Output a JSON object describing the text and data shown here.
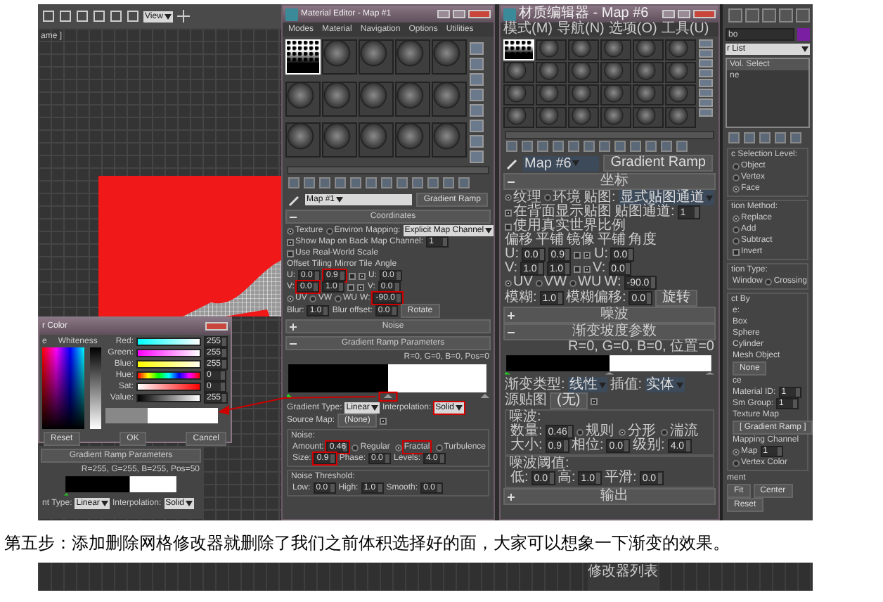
{
  "viewport": {
    "toolbar_dropdown": "View",
    "label": "ame ]"
  },
  "color_dialog": {
    "title": "r Color",
    "hue_label": "e",
    "whiteness_label": "Whiteness",
    "channels": [
      {
        "kind": "red",
        "name": "Red:",
        "value": "255"
      },
      {
        "kind": "green",
        "name": "Green:",
        "value": "255"
      },
      {
        "kind": "blue",
        "name": "Blue:",
        "value": "255"
      },
      {
        "kind": "hue",
        "name": "Hue:",
        "value": "0"
      },
      {
        "kind": "sat",
        "name": "Sat:",
        "value": "0"
      },
      {
        "kind": "value",
        "name": "Value:",
        "value": "255"
      }
    ],
    "buttons": [
      "Reset",
      "OK",
      "Cancel"
    ]
  },
  "ramp_panel": {
    "title": "Gradient Ramp Parameters",
    "readout": "R=255, G=255, B=255,  Pos=50",
    "type_label": "nt Type:",
    "type_value": "Linear",
    "interp_label": "Interpolation:",
    "interp_value": "Solid"
  },
  "editors": [
    {
      "kind": "latin",
      "title": "Material Editor - Map #1",
      "menus": [
        "Modes",
        "Material",
        "Navigation",
        "Options",
        "Utilities"
      ],
      "sample_rows": [
        [
          {
            "kind": "gradient"
          },
          {
            "kind": "sphere"
          },
          {
            "kind": "sphere"
          },
          {
            "kind": "sphere"
          },
          {
            "kind": "sphere"
          }
        ],
        [
          {
            "kind": "sphere"
          },
          {
            "kind": "sphere"
          },
          {
            "kind": "sphere"
          },
          {
            "kind": "sphere"
          },
          {
            "kind": "sphere"
          }
        ],
        [
          {
            "kind": "sphere"
          },
          {
            "kind": "sphere"
          },
          {
            "kind": "sphere"
          },
          {
            "kind": "sphere"
          },
          {
            "kind": "sphere"
          }
        ]
      ],
      "map_name": "Map #1",
      "map_type": "Gradient Ramp",
      "rows": [
        {
          "kind": "rollout",
          "title": "Coordinates",
          "expanded": true
        },
        {
          "kind": "cells",
          "cells": [
            {
              "kind": "radio",
              "label": "Texture",
              "selected": true
            },
            {
              "kind": "radio",
              "label": "Environ",
              "selected": false
            },
            {
              "kind": "label",
              "text": "Mapping:"
            },
            {
              "kind": "dropdown",
              "value": "Explicit Map Channel"
            }
          ]
        },
        {
          "kind": "cells",
          "cells": [
            {
              "kind": "check",
              "label": "Show Map on Back",
              "checked": true
            },
            {
              "kind": "label",
              "text": "Map Channel:"
            },
            {
              "kind": "field",
              "value": "1"
            }
          ]
        },
        {
          "kind": "cells",
          "cells": [
            {
              "kind": "check",
              "label": "Use Real-World Scale",
              "checked": false
            }
          ]
        },
        {
          "kind": "cells",
          "cells": [
            {
              "kind": "label",
              "text": "Offset"
            },
            {
              "kind": "label",
              "text": "Tiling"
            },
            {
              "kind": "label",
              "text": "Mirror Tile"
            },
            {
              "kind": "label",
              "text": "Angle"
            }
          ]
        },
        {
          "kind": "cells",
          "cells": [
            {
              "kind": "label",
              "text": "U:"
            },
            {
              "kind": "field",
              "value": "0.0"
            },
            {
              "kind": "field",
              "value": "0.9",
              "highlight": true
            },
            {
              "kind": "check",
              "checked": false
            },
            {
              "kind": "check",
              "checked": true
            },
            {
              "kind": "label",
              "text": "U:"
            },
            {
              "kind": "field",
              "value": "0.0"
            }
          ]
        },
        {
          "kind": "cells",
          "cells": [
            {
              "kind": "label",
              "text": "V:"
            },
            {
              "kind": "field",
              "value": "0.0",
              "highlight": true
            },
            {
              "kind": "field",
              "value": "1.0"
            },
            {
              "kind": "check",
              "checked": false
            },
            {
              "kind": "check",
              "checked": true
            },
            {
              "kind": "label",
              "text": "V:"
            },
            {
              "kind": "field",
              "value": "0.0"
            }
          ]
        },
        {
          "kind": "cells",
          "cells": [
            {
              "kind": "radio",
              "label": "UV",
              "selected": true
            },
            {
              "kind": "radio",
              "label": "VW",
              "selected": false
            },
            {
              "kind": "radio",
              "label": "WU",
              "selected": false
            },
            {
              "kind": "label",
              "text": "W:"
            },
            {
              "kind": "field",
              "value": "-90.0",
              "highlight": true
            }
          ]
        },
        {
          "kind": "cells",
          "cells": [
            {
              "kind": "label",
              "text": "Blur:"
            },
            {
              "kind": "field",
              "value": "1.0"
            },
            {
              "kind": "label",
              "text": "Blur offset:"
            },
            {
              "kind": "field",
              "value": "0.0"
            },
            {
              "kind": "button",
              "label": "Rotate"
            }
          ]
        },
        {
          "kind": "rollout",
          "title": "Noise",
          "expanded": false
        },
        {
          "kind": "rollout",
          "title": "Gradient Ramp Parameters",
          "expanded": true
        },
        {
          "kind": "ramp",
          "readout": "R=0, G=0, B=0,  Pos=0",
          "highlight": true
        },
        {
          "kind": "cells",
          "cells": [
            {
              "kind": "label",
              "text": "Gradient Type:"
            },
            {
              "kind": "dropdown",
              "value": "Linear"
            },
            {
              "kind": "label",
              "text": "Interpolation:"
            },
            {
              "kind": "dropdown",
              "value": "Solid",
              "highlight": true
            }
          ]
        },
        {
          "kind": "cells",
          "cells": [
            {
              "kind": "label",
              "text": "Source Map:"
            },
            {
              "kind": "button",
              "label": "(None)"
            },
            {
              "kind": "check",
              "checked": true
            }
          ]
        },
        {
          "kind": "group",
          "title": "Noise:",
          "rows": [
            {
              "kind": "cells",
              "cells": [
                {
                  "kind": "label",
                  "text": "Amount:"
                },
                {
                  "kind": "field",
                  "value": "0.46",
                  "highlight": true
                },
                {
                  "kind": "radios",
                  "options": [
                    {
                      "label": "Regular",
                      "selected": false
                    },
                    {
                      "label": "Fractal",
                      "selected": true,
                      "highlight": true
                    },
                    {
                      "label": "Turbulence",
                      "selected": false
                    }
                  ]
                }
              ]
            },
            {
              "kind": "cells",
              "cells": [
                {
                  "kind": "label",
                  "text": "Size:"
                },
                {
                  "kind": "field",
                  "value": "0.9",
                  "highlight": true
                },
                {
                  "kind": "label",
                  "text": "Phase:"
                },
                {
                  "kind": "field",
                  "value": "0.0"
                },
                {
                  "kind": "label",
                  "text": "Levels:"
                },
                {
                  "kind": "field",
                  "value": "4.0"
                }
              ]
            }
          ]
        },
        {
          "kind": "group",
          "title": "Noise Threshold:",
          "rows": [
            {
              "kind": "cells",
              "cells": [
                {
                  "kind": "label",
                  "text": "Low:"
                },
                {
                  "kind": "field",
                  "value": "0.0"
                },
                {
                  "kind": "label",
                  "text": "High:"
                },
                {
                  "kind": "field",
                  "value": "1.0"
                },
                {
                  "kind": "label",
                  "text": "Smooth:"
                },
                {
                  "kind": "field",
                  "value": "0.0"
                }
              ]
            }
          ]
        }
      ]
    },
    {
      "kind": "cjk",
      "title": "材质编辑器 - Map #6",
      "menus": [
        "模式(M)",
        "导航(N)",
        "选项(O)",
        "工具(U)"
      ],
      "sample_rows": [
        [
          {
            "kind": "gradient"
          },
          {
            "kind": "sphere"
          },
          {
            "kind": "sphere"
          },
          {
            "kind": "sphere"
          },
          {
            "kind": "sphere"
          },
          {
            "kind": "sphere"
          }
        ],
        [
          {
            "kind": "sphere"
          },
          {
            "kind": "sphere"
          },
          {
            "kind": "sphere"
          },
          {
            "kind": "sphere"
          },
          {
            "kind": "sphere"
          },
          {
            "kind": "sphere"
          }
        ],
        [
          {
            "kind": "sphere"
          },
          {
            "kind": "sphere"
          },
          {
            "kind": "sphere"
          },
          {
            "kind": "sphere"
          },
          {
            "kind": "sphere"
          },
          {
            "kind": "sphere"
          }
        ],
        [
          {
            "kind": "sphere"
          },
          {
            "kind": "sphere"
          },
          {
            "kind": "sphere"
          },
          {
            "kind": "sphere"
          },
          {
            "kind": "sphere"
          },
          {
            "kind": "sphere"
          }
        ]
      ],
      "map_name": "Map #6",
      "map_type": "Gradient Ramp",
      "rows": [
        {
          "kind": "rollout",
          "title": "坐标",
          "expanded": true
        },
        {
          "kind": "cells",
          "cells": [
            {
              "kind": "radio",
              "label": "纹理",
              "selected": true
            },
            {
              "kind": "radio",
              "label": "环境",
              "selected": false
            },
            {
              "kind": "label",
              "text": "贴图:"
            },
            {
              "kind": "dropdown",
              "value": "显式贴图通道"
            }
          ]
        },
        {
          "kind": "cells",
          "cells": [
            {
              "kind": "check",
              "label": "在背面显示贴图",
              "checked": true
            },
            {
              "kind": "label",
              "text": "贴图通道:"
            },
            {
              "kind": "field",
              "value": "1"
            }
          ]
        },
        {
          "kind": "cells",
          "cells": [
            {
              "kind": "check",
              "label": "使用真实世界比例",
              "checked": false
            }
          ]
        },
        {
          "kind": "cells",
          "cells": [
            {
              "kind": "label",
              "text": "偏移"
            },
            {
              "kind": "label",
              "text": "平铺"
            },
            {
              "kind": "label",
              "text": "镜像"
            },
            {
              "kind": "label",
              "text": "平铺"
            },
            {
              "kind": "label",
              "text": "角度"
            }
          ]
        },
        {
          "kind": "cells",
          "cells": [
            {
              "kind": "label",
              "text": "U:"
            },
            {
              "kind": "field",
              "value": "0.0"
            },
            {
              "kind": "field",
              "value": "0.9"
            },
            {
              "kind": "check",
              "checked": false
            },
            {
              "kind": "check",
              "checked": true
            },
            {
              "kind": "label",
              "text": "U:"
            },
            {
              "kind": "field",
              "value": "0.0"
            }
          ]
        },
        {
          "kind": "cells",
          "cells": [
            {
              "kind": "label",
              "text": "V:"
            },
            {
              "kind": "field",
              "value": "1.0"
            },
            {
              "kind": "field",
              "value": "1.0"
            },
            {
              "kind": "check",
              "checked": false
            },
            {
              "kind": "check",
              "checked": true
            },
            {
              "kind": "label",
              "text": "V:"
            },
            {
              "kind": "field",
              "value": "0.0"
            }
          ]
        },
        {
          "kind": "cells",
          "cells": [
            {
              "kind": "radio",
              "label": "UV",
              "selected": true
            },
            {
              "kind": "radio",
              "label": "VW",
              "selected": false
            },
            {
              "kind": "radio",
              "label": "WU",
              "selected": false
            },
            {
              "kind": "label",
              "text": "W:"
            },
            {
              "kind": "field",
              "value": "-90.0"
            }
          ]
        },
        {
          "kind": "cells",
          "cells": [
            {
              "kind": "label",
              "text": "模糊:"
            },
            {
              "kind": "field",
              "value": "1.0"
            },
            {
              "kind": "label",
              "text": "模糊偏移:"
            },
            {
              "kind": "field",
              "value": "0.0"
            },
            {
              "kind": "button",
              "label": "旋转"
            }
          ]
        },
        {
          "kind": "rollout",
          "title": "噪波",
          "expanded": false
        },
        {
          "kind": "rollout",
          "title": "渐变坡度参数",
          "expanded": true
        },
        {
          "kind": "ramp",
          "readout": "R=0, G=0, B=0,  位置=0"
        },
        {
          "kind": "cells",
          "cells": [
            {
              "kind": "label",
              "text": "渐变类型:"
            },
            {
              "kind": "dropdown",
              "value": "线性"
            },
            {
              "kind": "label",
              "text": "插值:"
            },
            {
              "kind": "dropdown",
              "value": "实体"
            }
          ]
        },
        {
          "kind": "cells",
          "cells": [
            {
              "kind": "label",
              "text": "源贴图"
            },
            {
              "kind": "button",
              "label": "(无)"
            },
            {
              "kind": "check",
              "checked": true
            }
          ]
        },
        {
          "kind": "group",
          "title": "噪波:",
          "rows": [
            {
              "kind": "cells",
              "cells": [
                {
                  "kind": "label",
                  "text": "数量:"
                },
                {
                  "kind": "field",
                  "value": "0.46"
                },
                {
                  "kind": "radios",
                  "options": [
                    {
                      "label": "规则",
                      "selected": false
                    },
                    {
                      "label": "分形",
                      "selected": true
                    },
                    {
                      "label": "湍流",
                      "selected": false
                    }
                  ]
                }
              ]
            },
            {
              "kind": "cells",
              "cells": [
                {
                  "kind": "label",
                  "text": "大小:"
                },
                {
                  "kind": "field",
                  "value": "0.9"
                },
                {
                  "kind": "label",
                  "text": "相位:"
                },
                {
                  "kind": "field",
                  "value": "0.0"
                },
                {
                  "kind": "label",
                  "text": "级别:"
                },
                {
                  "kind": "field",
                  "value": "4.0"
                }
              ]
            }
          ]
        },
        {
          "kind": "group",
          "title": "噪波阈值:",
          "rows": [
            {
              "kind": "cells",
              "cells": [
                {
                  "kind": "label",
                  "text": "低:"
                },
                {
                  "kind": "field",
                  "value": "0.0"
                },
                {
                  "kind": "label",
                  "text": "高:"
                },
                {
                  "kind": "field",
                  "value": "1.0"
                },
                {
                  "kind": "label",
                  "text": "平滑:"
                },
                {
                  "kind": "field",
                  "value": "0.0"
                }
              ]
            }
          ]
        },
        {
          "kind": "rollout",
          "title": "输出",
          "expanded": false
        }
      ]
    }
  ],
  "command_panel": {
    "object_name": "bo",
    "modifier_list": "r List",
    "stack": [
      "Vol. Select",
      "ne"
    ],
    "rows": [
      {
        "kind": "group",
        "title": "c Selection Level:",
        "rows": [
          {
            "kind": "cells",
            "cells": [
              {
                "kind": "radio",
                "label": "Object",
                "selected": false
              }
            ]
          },
          {
            "kind": "cells",
            "cells": [
              {
                "kind": "radio",
                "label": "Vertex",
                "selected": false
              }
            ]
          },
          {
            "kind": "cells",
            "cells": [
              {
                "kind": "radio",
                "label": "Face",
                "selected": true
              }
            ]
          }
        ]
      },
      {
        "kind": "group",
        "title": "tion Method:",
        "rows": [
          {
            "kind": "cells",
            "cells": [
              {
                "kind": "radio",
                "label": "Replace",
                "selected": true
              }
            ]
          },
          {
            "kind": "cells",
            "cells": [
              {
                "kind": "radio",
                "label": "Add",
                "selected": false
              }
            ]
          },
          {
            "kind": "cells",
            "cells": [
              {
                "kind": "radio",
                "label": "Subtract",
                "selected": false
              }
            ]
          },
          {
            "kind": "cells",
            "cells": [
              {
                "kind": "check",
                "label": "Invert",
                "checked": false
              }
            ]
          }
        ]
      },
      {
        "kind": "group",
        "title": "tion Type:",
        "rows": [
          {
            "kind": "cells",
            "cells": [
              {
                "kind": "label",
                "text": "Window"
              },
              {
                "kind": "radio",
                "label": "Crossing",
                "selected": false
              }
            ]
          }
        ]
      },
      {
        "kind": "group",
        "title": "ct By",
        "rows": [
          {
            "kind": "cells",
            "cells": [
              {
                "kind": "label",
                "text": "e:"
              }
            ]
          },
          {
            "kind": "cells",
            "cells": [
              {
                "kind": "label",
                "text": "Box"
              }
            ]
          },
          {
            "kind": "cells",
            "cells": [
              {
                "kind": "label",
                "text": "Sphere"
              }
            ]
          },
          {
            "kind": "cells",
            "cells": [
              {
                "kind": "label",
                "text": "Cylinder"
              }
            ]
          },
          {
            "kind": "cells",
            "cells": [
              {
                "kind": "label",
                "text": "Mesh Object"
              }
            ]
          },
          {
            "kind": "cells",
            "cells": [
              {
                "kind": "button",
                "label": "None"
              }
            ]
          },
          {
            "kind": "cells",
            "cells": [
              {
                "kind": "label",
                "text": "ce"
              }
            ]
          },
          {
            "kind": "cells",
            "cells": [
              {
                "kind": "label",
                "text": "Material ID:"
              },
              {
                "kind": "field",
                "value": "1"
              }
            ]
          },
          {
            "kind": "cells",
            "cells": [
              {
                "kind": "label",
                "text": "Sm Group:"
              },
              {
                "kind": "field",
                "value": "1"
              }
            ]
          },
          {
            "kind": "cells",
            "cells": [
              {
                "kind": "label",
                "text": "Texture Map"
              }
            ]
          },
          {
            "kind": "cells",
            "cells": [
              {
                "kind": "button",
                "label": "[ Gradient Ramp ]"
              }
            ]
          },
          {
            "kind": "cells",
            "cells": [
              {
                "kind": "label",
                "text": "Mapping Channel"
              }
            ]
          },
          {
            "kind": "cells",
            "cells": [
              {
                "kind": "radio",
                "label": "Map",
                "selected": true
              },
              {
                "kind": "field",
                "value": "1"
              }
            ]
          },
          {
            "kind": "cells",
            "cells": [
              {
                "kind": "radio",
                "label": "Vertex Color",
                "selected": false
              }
            ]
          }
        ]
      },
      {
        "kind": "cells",
        "cells": [
          {
            "kind": "label",
            "text": "ment"
          }
        ]
      },
      {
        "kind": "cells",
        "cells": [
          {
            "kind": "button",
            "label": "Fit"
          },
          {
            "kind": "button",
            "label": "Center"
          }
        ]
      },
      {
        "kind": "cells",
        "cells": [
          {
            "kind": "button",
            "label": "Reset"
          }
        ]
      }
    ]
  },
  "caption": "第五步：添加删除网格修改器就删除了我们之前体积选择好的面，大家可以想象一下渐变的效果。",
  "next_image": {
    "label": "修改器列表"
  }
}
